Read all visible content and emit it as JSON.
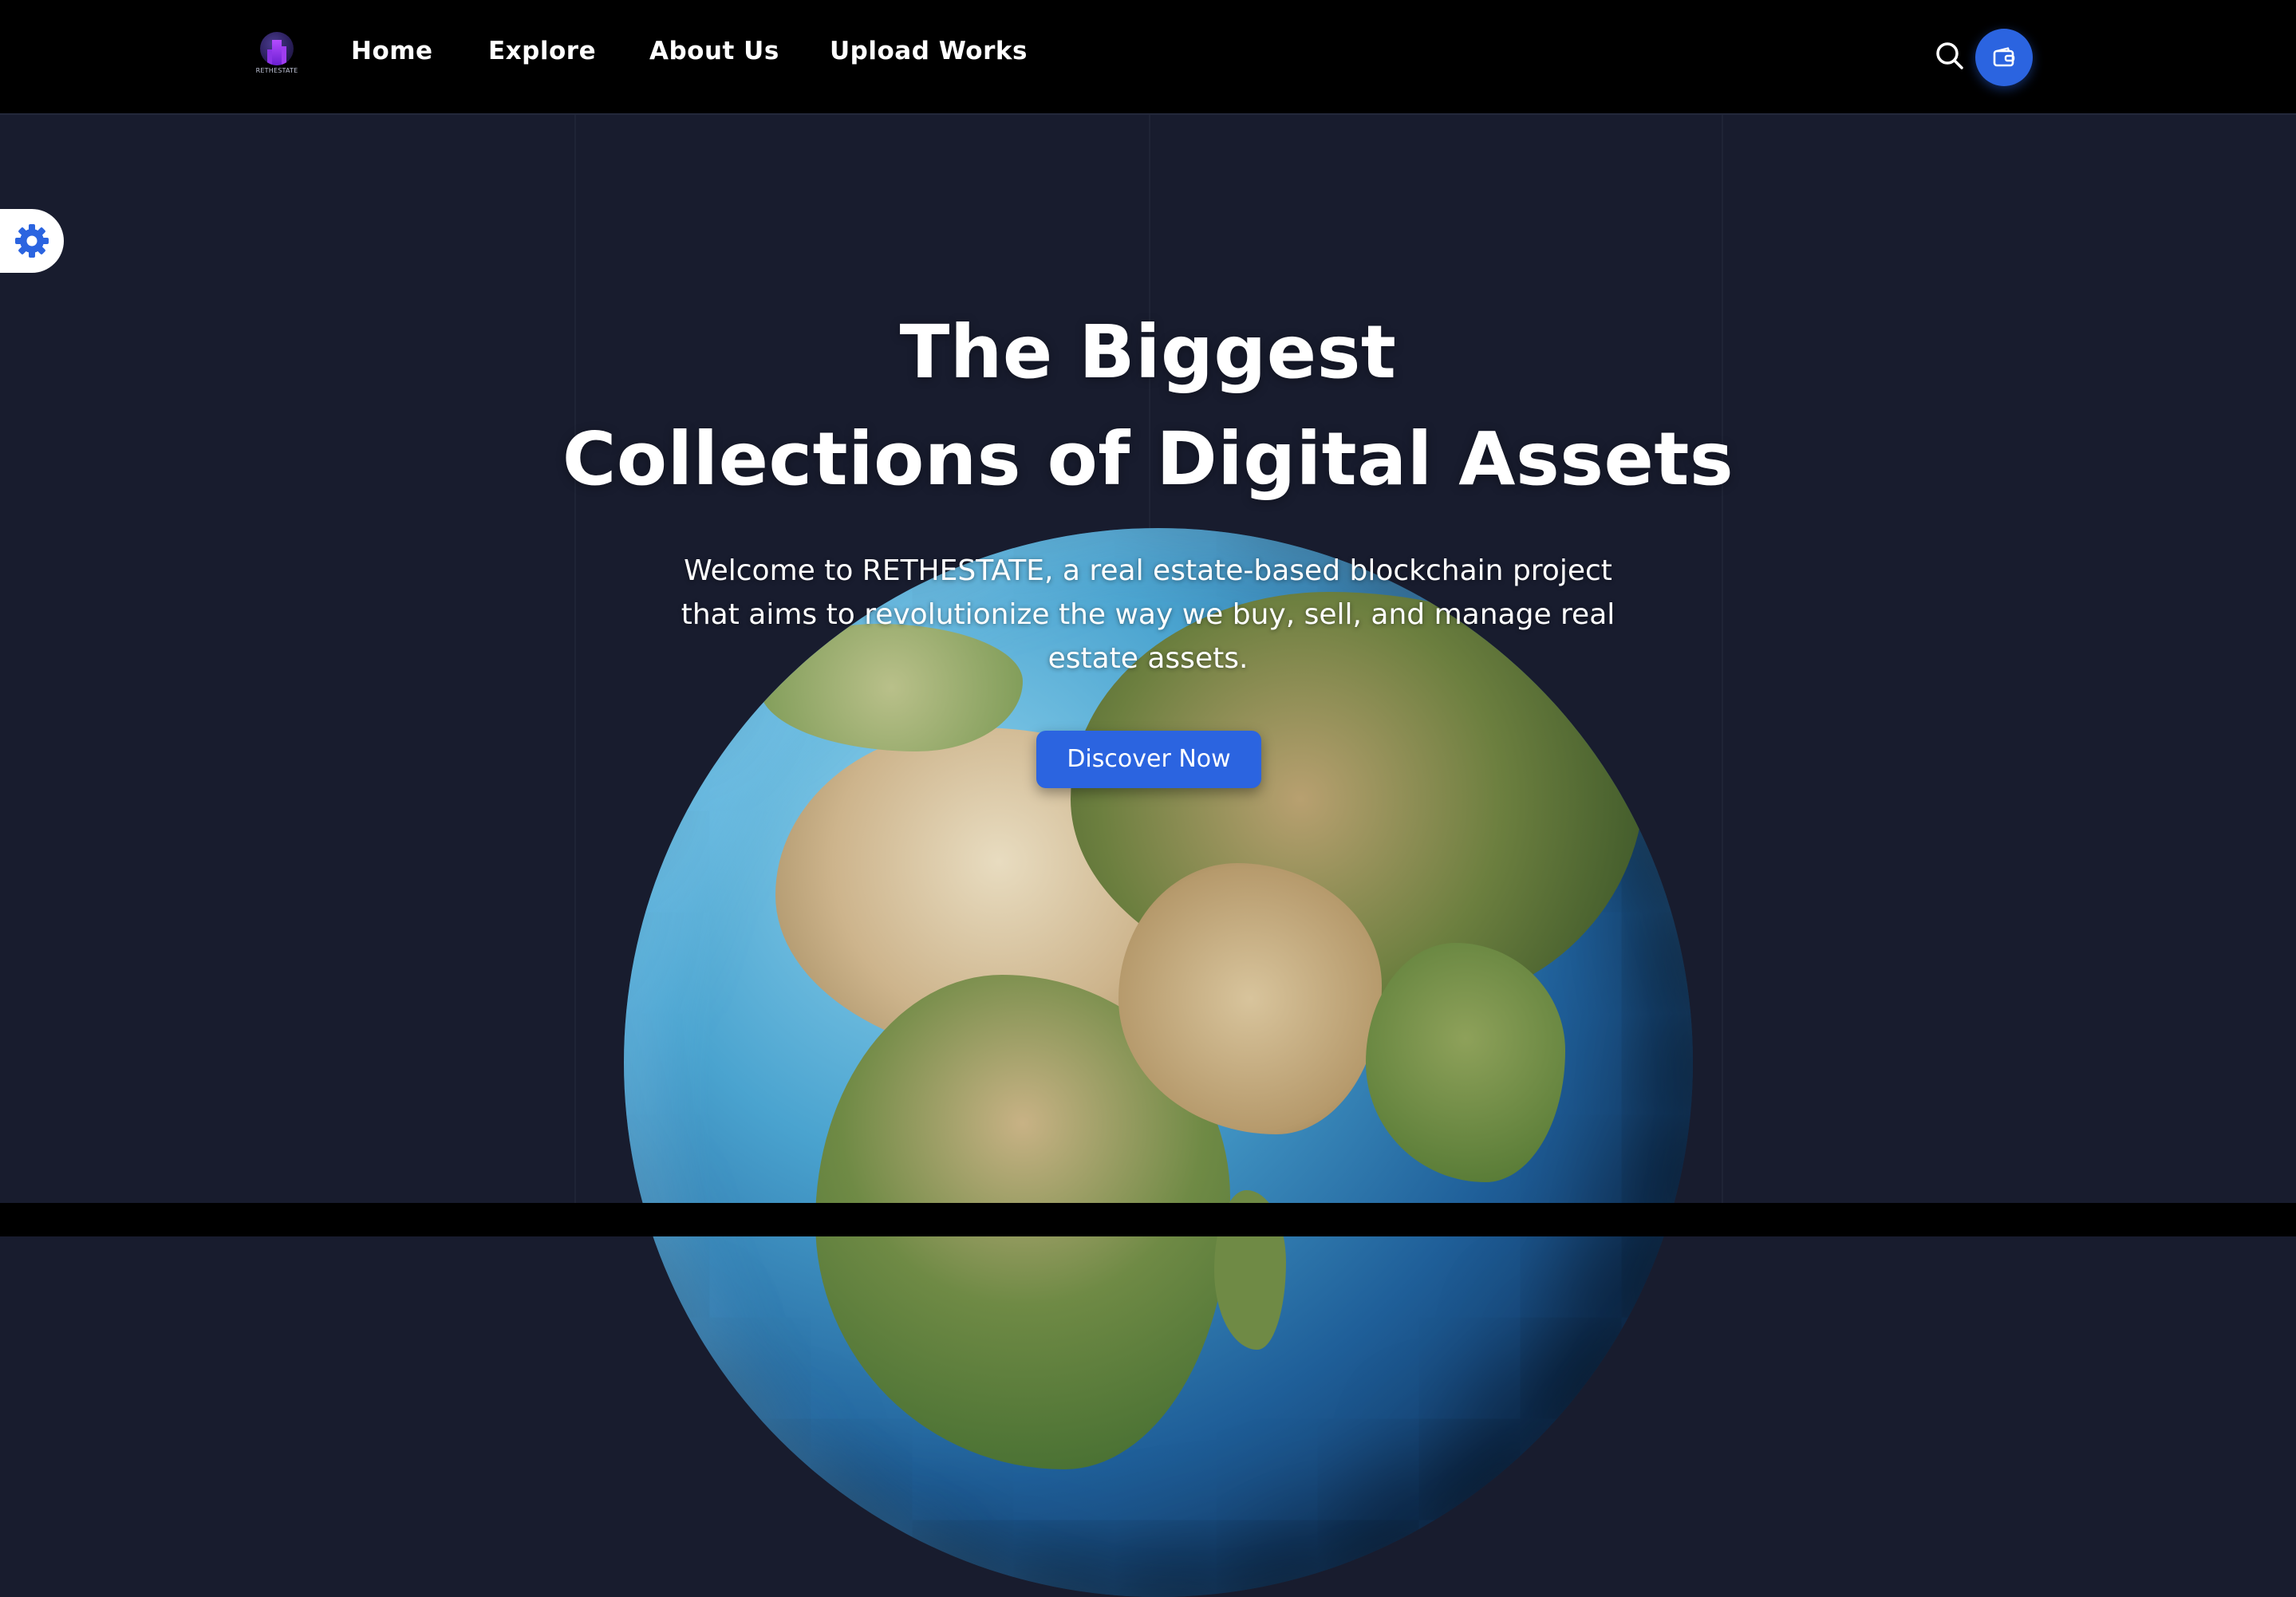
{
  "brand": {
    "logo_text": "RETHESTATE"
  },
  "nav": {
    "items": [
      {
        "label": "Home"
      },
      {
        "label": "Explore"
      },
      {
        "label": "About Us"
      },
      {
        "label": "Upload Works"
      }
    ],
    "search_icon": "search-icon",
    "wallet_icon": "wallet-icon"
  },
  "settings": {
    "icon": "gear-icon"
  },
  "hero": {
    "title_line1": "The Biggest",
    "title_line2": "Collections of Digital Assets",
    "description": "Welcome to RETHESTATE, a real estate-based blockchain project that aims to revolutionize the way we buy, sell, and manage real estate assets.",
    "cta_label": "Discover Now"
  },
  "colors": {
    "accent": "#2b64e0",
    "header_bg": "#000000",
    "page_bg": "#181c2e"
  }
}
